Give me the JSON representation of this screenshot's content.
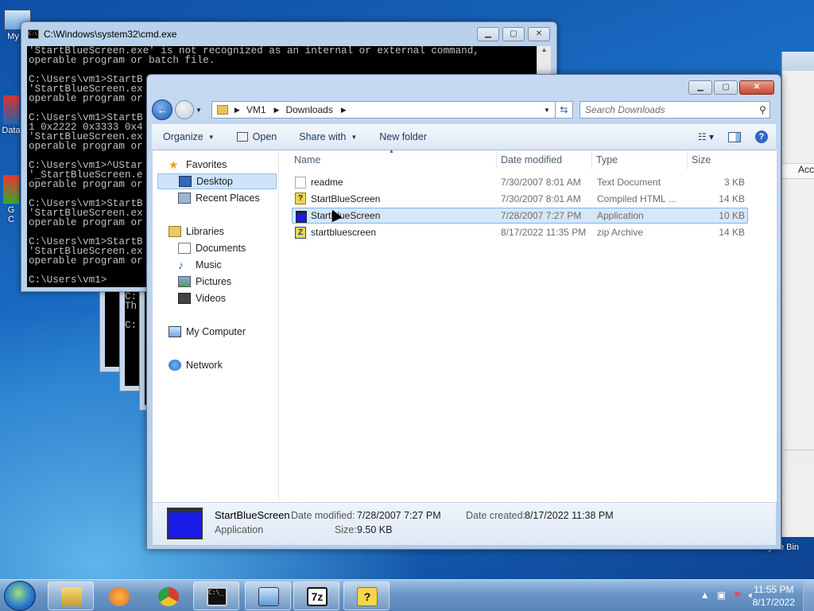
{
  "desktop": {
    "icons": [
      {
        "label": "My C",
        "icon": "computer-icon"
      },
      {
        "label": "Data",
        "icon": "data-icon"
      },
      {
        "label": "G\nC",
        "icon": "chrome-icon"
      }
    ],
    "recycle_bin": "Recycle Bin",
    "right_window_label": "Acc"
  },
  "cmd": {
    "title": "C:\\Windows\\system32\\cmd.exe",
    "lines": [
      "'StartBlueScreen.exe' is not recognized as an internal or external command,",
      "operable program or batch file.",
      "",
      "C:\\Users\\vm1>StartB",
      "'StartBlueScreen.ex",
      "operable program or",
      "",
      "C:\\Users\\vm1>StartB",
      "1 0x2222 0x3333 0x4",
      "'StartBlueScreen.ex",
      "operable program or",
      "",
      "C:\\Users\\vm1>^UStar",
      "'_StartBlueScreen.e",
      "operable program or",
      "",
      "C:\\Users\\vm1>StartB",
      "'StartBlueScreen.ex",
      "operable program or",
      "",
      "C:\\Users\\vm1>StartB",
      "'StartBlueScreen.ex",
      "operable program or",
      "",
      "C:\\Users\\vm1>"
    ],
    "bg_window_lines": [
      "C:",
      "Th",
      "",
      "C:"
    ]
  },
  "explorer": {
    "breadcrumbs": [
      "VM1",
      "Downloads"
    ],
    "search_placeholder": "Search Downloads",
    "toolbar": {
      "organize": "Organize",
      "open": "Open",
      "share": "Share with",
      "new_folder": "New folder"
    },
    "nav": {
      "favorites": "Favorites",
      "desktop": "Desktop",
      "recent": "Recent Places",
      "libraries": "Libraries",
      "documents": "Documents",
      "music": "Music",
      "pictures": "Pictures",
      "videos": "Videos",
      "computer": "My Computer",
      "network": "Network"
    },
    "columns": {
      "name": "Name",
      "date": "Date modified",
      "type": "Type",
      "size": "Size"
    },
    "files": [
      {
        "name": "readme",
        "date": "7/30/2007 8:01 AM",
        "type": "Text Document",
        "size": "3 KB",
        "icon": "text-file-icon"
      },
      {
        "name": "StartBlueScreen",
        "date": "7/30/2007 8:01 AM",
        "type": "Compiled HTML ...",
        "size": "14 KB",
        "icon": "chm-file-icon"
      },
      {
        "name": "StartBlueScreen",
        "date": "7/28/2007 7:27 PM",
        "type": "Application",
        "size": "10 KB",
        "icon": "app-file-icon"
      },
      {
        "name": "startbluescreen",
        "date": "8/17/2022 11:35 PM",
        "type": "zip Archive",
        "size": "14 KB",
        "icon": "zip-file-icon"
      }
    ],
    "details": {
      "name": "StartBlueScreen",
      "kind": "Application",
      "modified_label": "Date modified:",
      "modified": "7/28/2007 7:27 PM",
      "created_label": "Date created:",
      "created": "8/17/2022 11:38 PM",
      "size_label": "Size:",
      "size": "9.50 KB"
    }
  },
  "taskbar": {
    "time": "11:55 PM",
    "date": "8/17/2022",
    "apps": [
      "explorer-icon",
      "media-player-icon",
      "chrome-icon",
      "cmd-icon",
      "network-app-icon",
      "7zip-icon",
      "help-icon"
    ]
  },
  "colors": {
    "accent": "#1c5bb6",
    "selection": "#d5e7fa"
  }
}
